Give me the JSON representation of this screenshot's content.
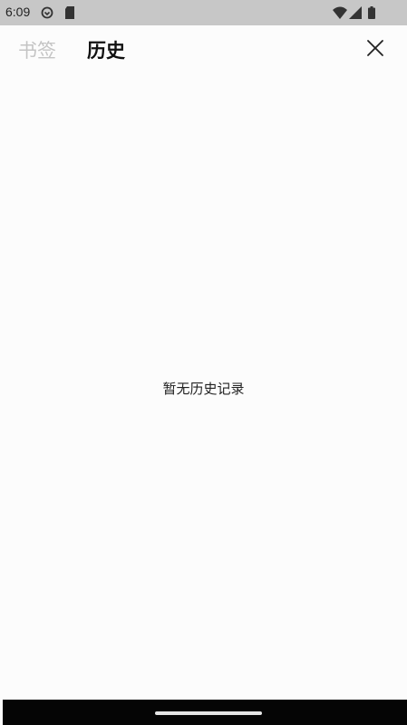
{
  "status_bar": {
    "time": "6:09",
    "icons_left": [
      "sync-icon",
      "sd-card-icon"
    ],
    "icons_right": [
      "wifi-icon",
      "signal-icon",
      "battery-icon"
    ]
  },
  "header": {
    "tabs": [
      {
        "label": "书签",
        "active": false
      },
      {
        "label": "历史",
        "active": true
      }
    ],
    "close_icon": "close-icon"
  },
  "main": {
    "empty_message": "暂无历史记录"
  },
  "colors": {
    "status_bar_bg": "#c7c7c7",
    "page_bg": "#fcfcfc",
    "inactive_tab": "#c4c4c4",
    "active_tab": "#111111",
    "nav_bar_bg": "#050505"
  }
}
